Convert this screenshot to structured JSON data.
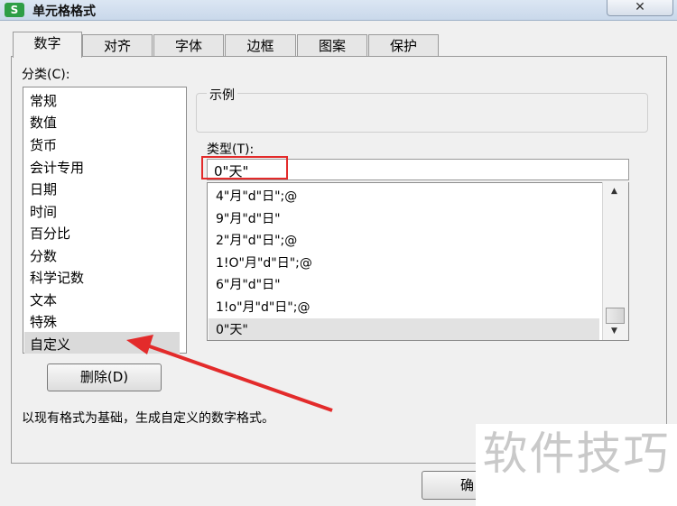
{
  "window": {
    "title": "单元格格式",
    "app_icon_letter": "S",
    "close_symbol": "✕"
  },
  "tabs": [
    {
      "label": "数字",
      "active": true
    },
    {
      "label": "对齐"
    },
    {
      "label": "字体"
    },
    {
      "label": "边框"
    },
    {
      "label": "图案"
    },
    {
      "label": "保护"
    }
  ],
  "category": {
    "label": "分类(C):",
    "items": [
      "常规",
      "数值",
      "货币",
      "会计专用",
      "日期",
      "时间",
      "百分比",
      "分数",
      "科学记数",
      "文本",
      "特殊",
      "自定义"
    ],
    "selected": "自定义"
  },
  "sample": {
    "label": "示例",
    "value": ""
  },
  "type": {
    "label": "类型(T):",
    "value": "0\"天\"",
    "formats": [
      "4\"月\"d\"日\";@",
      "9\"月\"d\"日\"",
      "2\"月\"d\"日\";@",
      "1!O\"月\"d\"日\";@",
      "6\"月\"d\"日\"",
      "1!o\"月\"d\"日\";@",
      "0\"天\""
    ],
    "selected_format": "0\"天\""
  },
  "buttons": {
    "delete_label": "删除(D)",
    "ok_label_partial": "确"
  },
  "description": "以现有格式为基础，生成自定义的数字格式。",
  "watermark": "软件技巧",
  "colors": {
    "highlight_border": "#e32b2b",
    "arrow": "#e32b2b"
  },
  "icons": {
    "scroll_up": "▲",
    "scroll_down": "▼"
  }
}
